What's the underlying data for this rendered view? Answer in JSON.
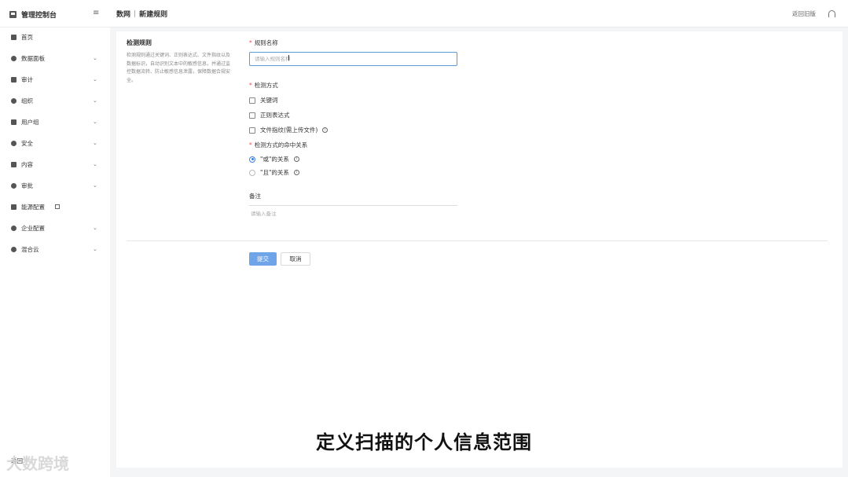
{
  "header": {
    "app_title": "管理控制台",
    "breadcrumb_parent": "数网",
    "breadcrumb_separator": "|",
    "breadcrumb_current": "新建规则",
    "right_link": "返回旧版"
  },
  "sidebar": {
    "items": [
      {
        "label": "首页"
      },
      {
        "label": "数据面板"
      },
      {
        "label": "审计"
      },
      {
        "label": "组织"
      },
      {
        "label": "用户组"
      },
      {
        "label": "安全"
      },
      {
        "label": "内容"
      },
      {
        "label": "审批"
      },
      {
        "label": "能源配置"
      },
      {
        "label": "企业配置"
      },
      {
        "label": "混合云"
      }
    ],
    "bottom_label": "返回"
  },
  "form": {
    "section_title": "检测规则",
    "section_desc": "检测规则通过关键词、正则表达式、文件指纹以及数据标识，自动识别文本中的敏感信息，并通过监控数据流转、防止敏感信息泄露，保障数据合规安全。",
    "rule_name_label": "规则名称",
    "rule_name_placeholder": "请输入规则名称",
    "method_label": "检测方式",
    "methods": [
      {
        "label": "关键词"
      },
      {
        "label": "正则表达式"
      },
      {
        "label": "文件指纹(需上传文件)"
      }
    ],
    "relation_label": "检测方式的命中关系",
    "relations": [
      {
        "label": "\"或\"的关系",
        "selected": true
      },
      {
        "label": "\"且\"的关系",
        "selected": false
      }
    ],
    "remark_label": "备注",
    "remark_placeholder": "请输入备注",
    "submit_label": "提交",
    "cancel_label": "取消"
  },
  "overlay": {
    "subtitle": "定义扫描的个人信息范围",
    "watermark": "大数跨境"
  },
  "colors": {
    "primary": "#3a7de0",
    "submit_bg": "#6fa5e8",
    "required": "#e34d59"
  }
}
